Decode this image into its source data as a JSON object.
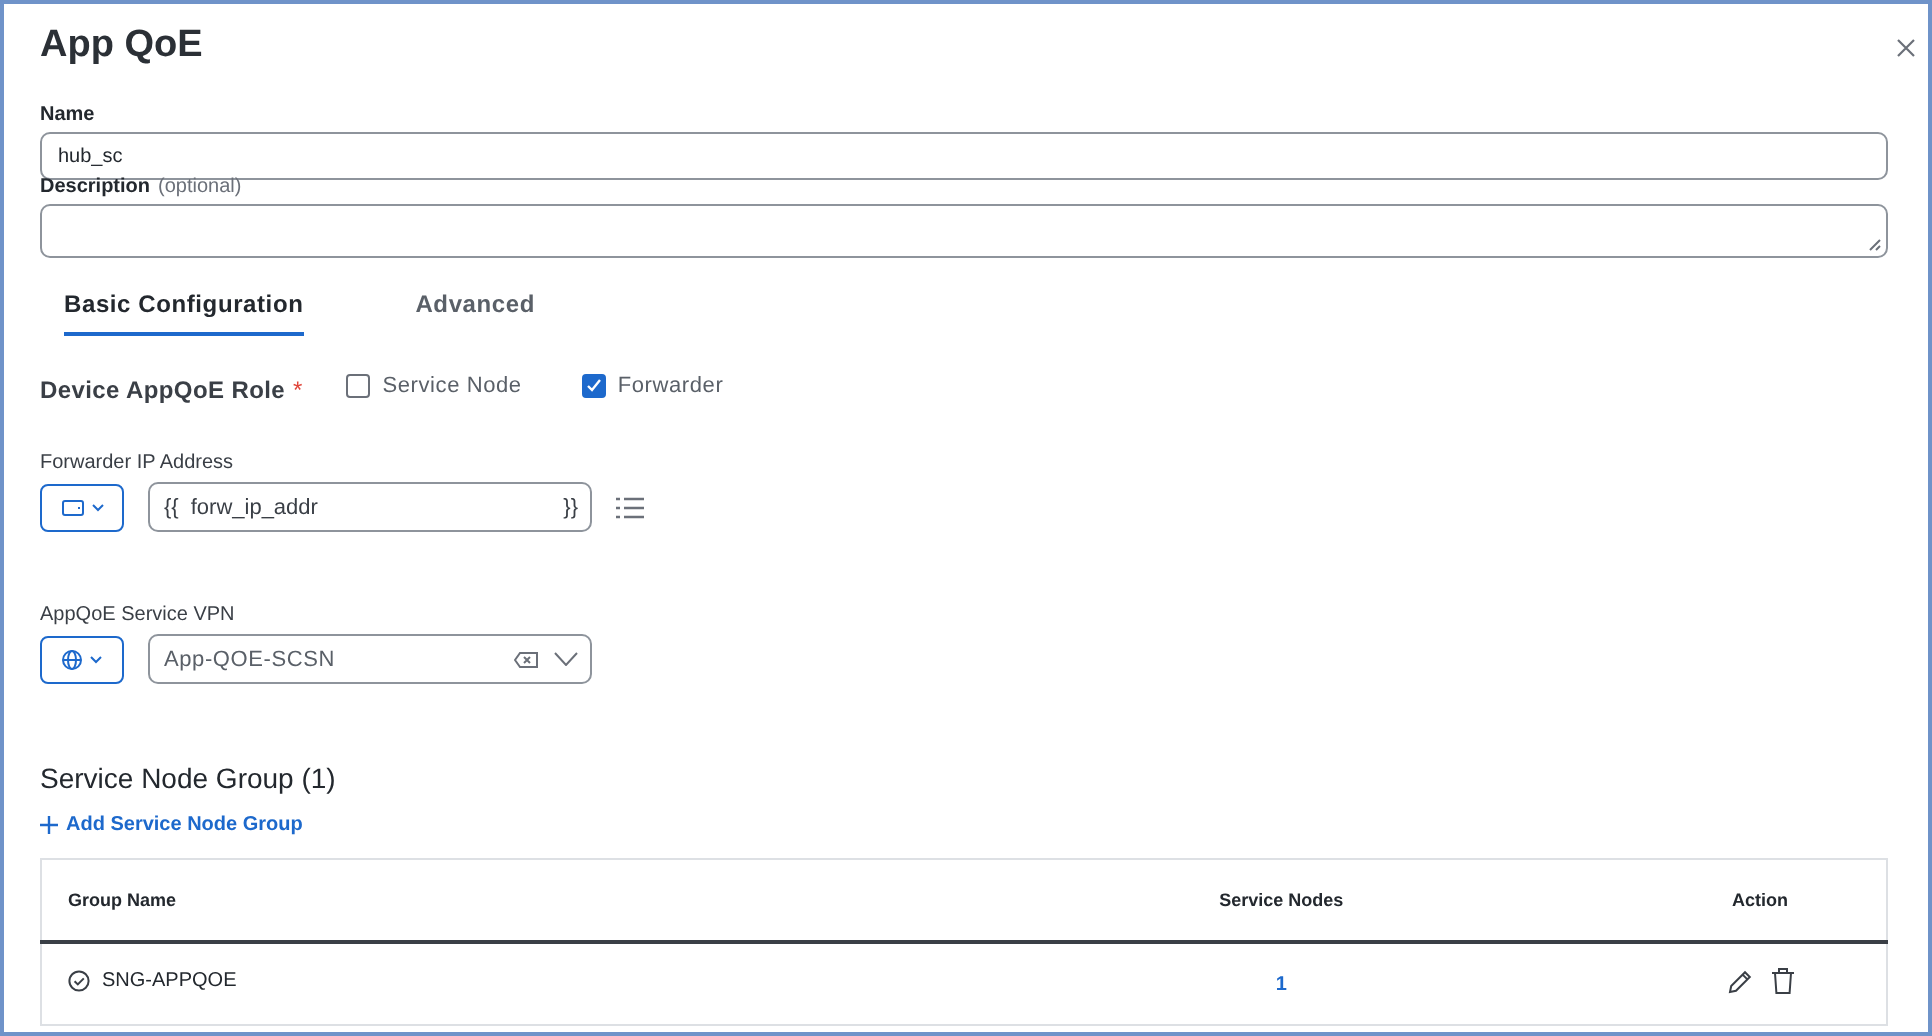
{
  "dialog": {
    "title": "App QoE"
  },
  "name_field": {
    "label": "Name",
    "value": "hub_sc"
  },
  "description_field": {
    "label": "Description",
    "hint": "(optional)"
  },
  "tabs": [
    {
      "label": "Basic Configuration",
      "selected": true
    },
    {
      "label": "Advanced",
      "selected": false
    }
  ],
  "role": {
    "label": "Device AppQoE Role",
    "required_mark": "*",
    "options": [
      {
        "label": "Service Node",
        "checked": false
      },
      {
        "label": "Forwarder",
        "checked": true
      }
    ]
  },
  "forwarder_ip": {
    "label": "Forwarder IP Address",
    "prefix": "{{",
    "value": "forw_ip_addr",
    "suffix": "}}"
  },
  "service_vpn": {
    "label": "AppQoE Service VPN",
    "value": "App-QOE-SCSN"
  },
  "service_node_group": {
    "title": "Service Node Group (1)",
    "add_link": "Add Service Node Group",
    "columns": [
      "Group Name",
      "Service Nodes",
      "Action"
    ],
    "rows": [
      {
        "group_name": "SNG-APPQOE",
        "service_nodes": "1"
      }
    ]
  }
}
